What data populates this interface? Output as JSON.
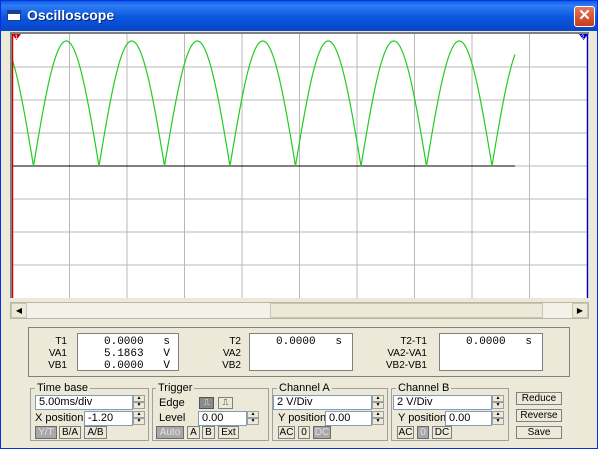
{
  "window": {
    "title": "Oscilloscope"
  },
  "screen": {
    "grid_color": "#b8b8b8",
    "trace_a_color": "#22cc22",
    "trace_b_color": "#000000",
    "cursor_1_label": "1",
    "cursor_2_label": "2"
  },
  "measure": {
    "t1_label": "T1",
    "va1_label": "VA1",
    "vb1_label": "VB1",
    "t1_value": "0.0000   s",
    "va1_value": "5.1863   V",
    "vb1_value": "0.0000   V",
    "t2_label": "T2",
    "va2_label": "VA2",
    "vb2_label": "VB2",
    "t2_value": "0.0000   s",
    "dt_label": "T2-T1",
    "dva_label": "VA2-VA1",
    "dvb_label": "VB2-VB1",
    "dt_value": "0.0000   s"
  },
  "timebase": {
    "label": "Time base",
    "scale": "5.00ms/div",
    "xpos_label": "X position",
    "xpos": "-1.20",
    "mode_yt": "Y/T",
    "mode_ba": "B/A",
    "mode_ab": "A/B"
  },
  "trigger": {
    "label": "Trigger",
    "edge_label": "Edge",
    "level_label": "Level",
    "level": "0.00",
    "auto": "Auto",
    "a": "A",
    "b": "B",
    "ext": "Ext"
  },
  "channel_a": {
    "label": "Channel A",
    "scale": "2 V/Div",
    "ypos_label": "Y position",
    "ypos": "0.00",
    "ac": "AC",
    "zero": "0",
    "dc": "DC"
  },
  "channel_b": {
    "label": "Channel B",
    "scale": "2 V/Div",
    "ypos_label": "Y position",
    "ypos": "0.00",
    "ac": "AC",
    "zero": "0",
    "dc": "DC"
  },
  "actions": {
    "reduce": "Reduce",
    "reverse": "Reverse",
    "save": "Save"
  }
}
